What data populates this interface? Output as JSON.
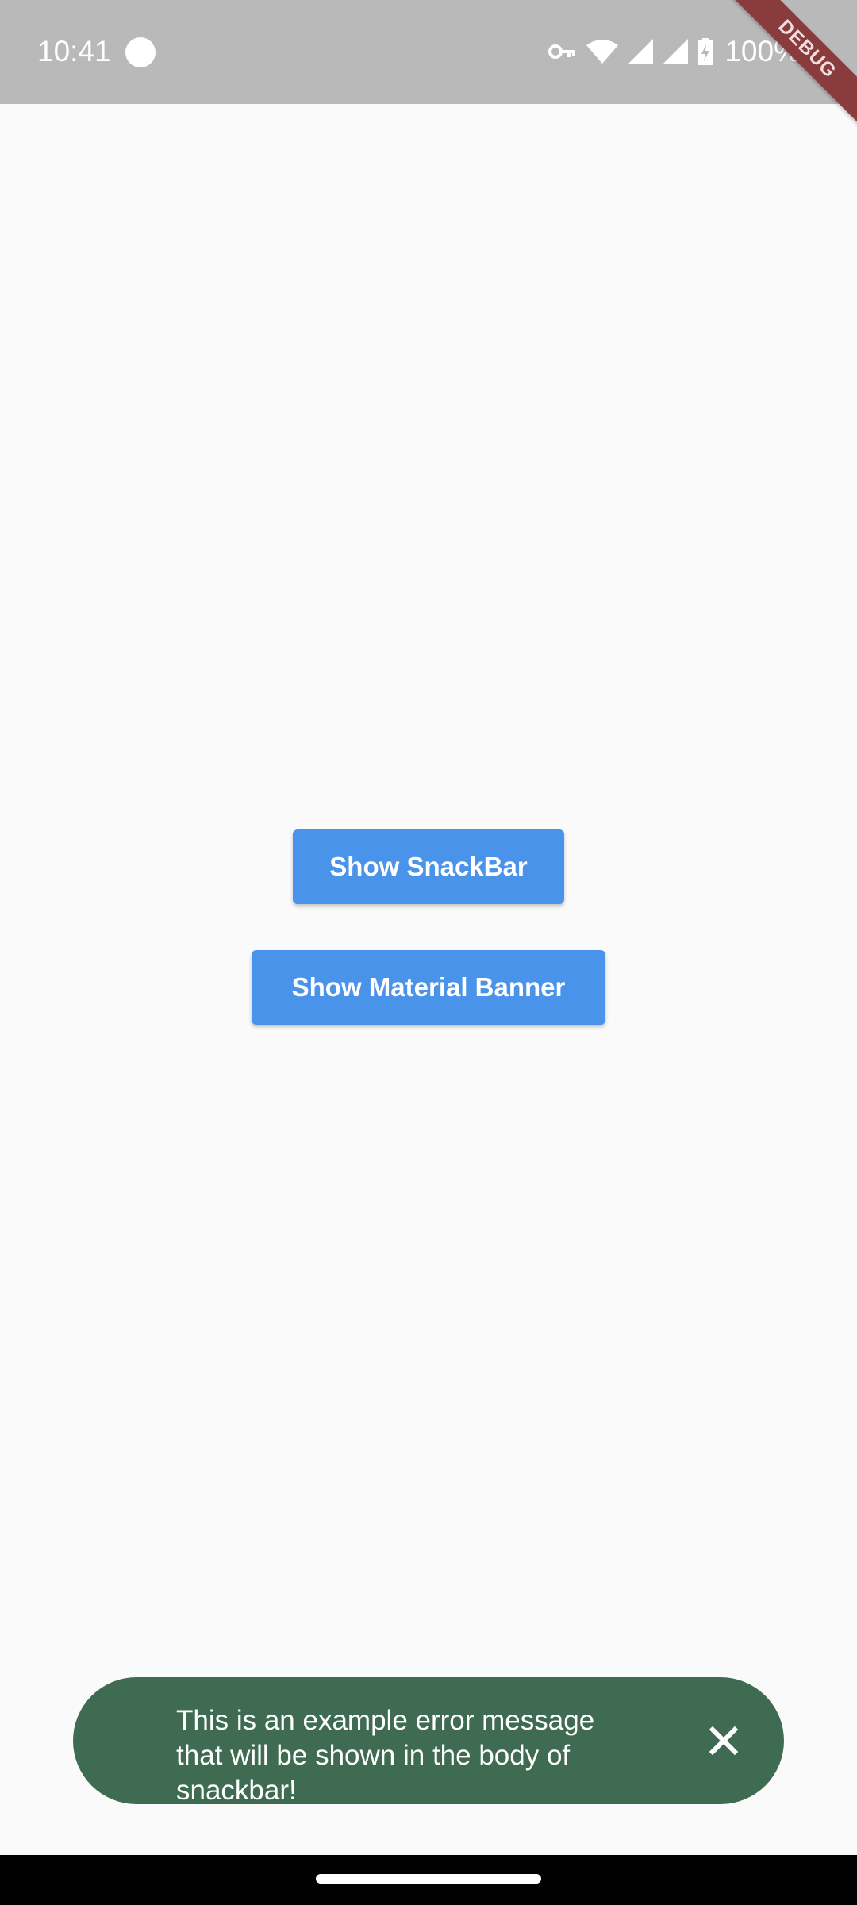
{
  "status_bar": {
    "time": "10:41",
    "battery": "100%",
    "icons": [
      "record-dot-icon",
      "vpn-key-icon",
      "wifi-icon",
      "signal-icon",
      "signal-icon-2",
      "battery-charging-icon"
    ],
    "background_color": "#b9b9b9"
  },
  "debug_banner": {
    "label": "DEBUG",
    "color": "#8a3b3b"
  },
  "buttons": {
    "show_snackbar": "Show SnackBar",
    "show_material_banner": "Show Material Banner",
    "color": "#4a93eb"
  },
  "snackbar": {
    "message": "This is an example error message that will be shown in the body of snackbar!",
    "close_icon": "close-icon",
    "background_color": "#3e6b51"
  },
  "nav_bar": {
    "handle": "gesture-handle"
  }
}
